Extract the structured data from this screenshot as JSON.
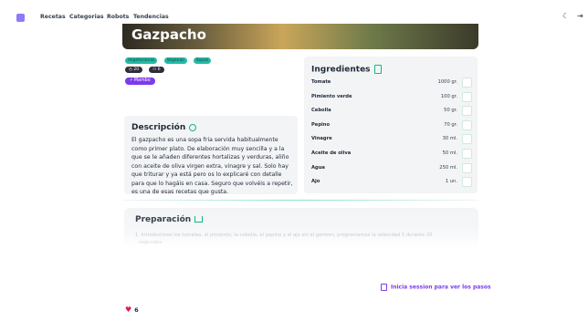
{
  "nav": {
    "links": [
      "Recetas",
      "Categorias",
      "Robots",
      "Tendencias"
    ],
    "theme_icon": "moon-icon",
    "login_icon": "login-icon"
  },
  "recipe": {
    "title": "Gazpacho",
    "tags": [
      "Vegetarianas",
      "Veganas",
      "Sopas"
    ],
    "time": "20",
    "servings": "6",
    "author": "Mambo"
  },
  "description": {
    "title": "Descripción",
    "text": "El gazpacho es una sopa fria servida habitualmente como primer plato. De elaboración muy sencilla y a la que se le añaden diferentes hortalizas y verduras, aliño con aceite de oliva virgen extra, vinagre y sal. Solo hay que triturar y ya está pero os lo explicaré con detalle para que lo hagáis en casa. Seguro que volvéis a repetir, es una de esas recetas que gusta."
  },
  "ingredients": {
    "title": "Ingredientes",
    "items": [
      {
        "name": "Tomate",
        "qty": "1000 gr."
      },
      {
        "name": "Pimiento verde",
        "qty": "100 gr."
      },
      {
        "name": "Cebolla",
        "qty": "50 gr."
      },
      {
        "name": "Pepino",
        "qty": "70 gr."
      },
      {
        "name": "Vinagre",
        "qty": "30 ml."
      },
      {
        "name": "Aceite de oliva",
        "qty": "50 ml."
      },
      {
        "name": "Agua",
        "qty": "250 ml."
      },
      {
        "name": "Ajo",
        "qty": "1 un."
      }
    ]
  },
  "preparation": {
    "title": "Preparación",
    "step_number": "1",
    "step_text": "Introducimos los tomates, el pimiento, la cebolla, el pepino y el ajo sin el germen, programamos la velocidad 5 durante 20",
    "step_text_cont": "segundos."
  },
  "login_prompt": "Inicia session para ver los pasos",
  "likes": "6",
  "colors": {
    "accent": "#7c3aed",
    "tag": "#26b7a3",
    "green": "#10b981"
  }
}
